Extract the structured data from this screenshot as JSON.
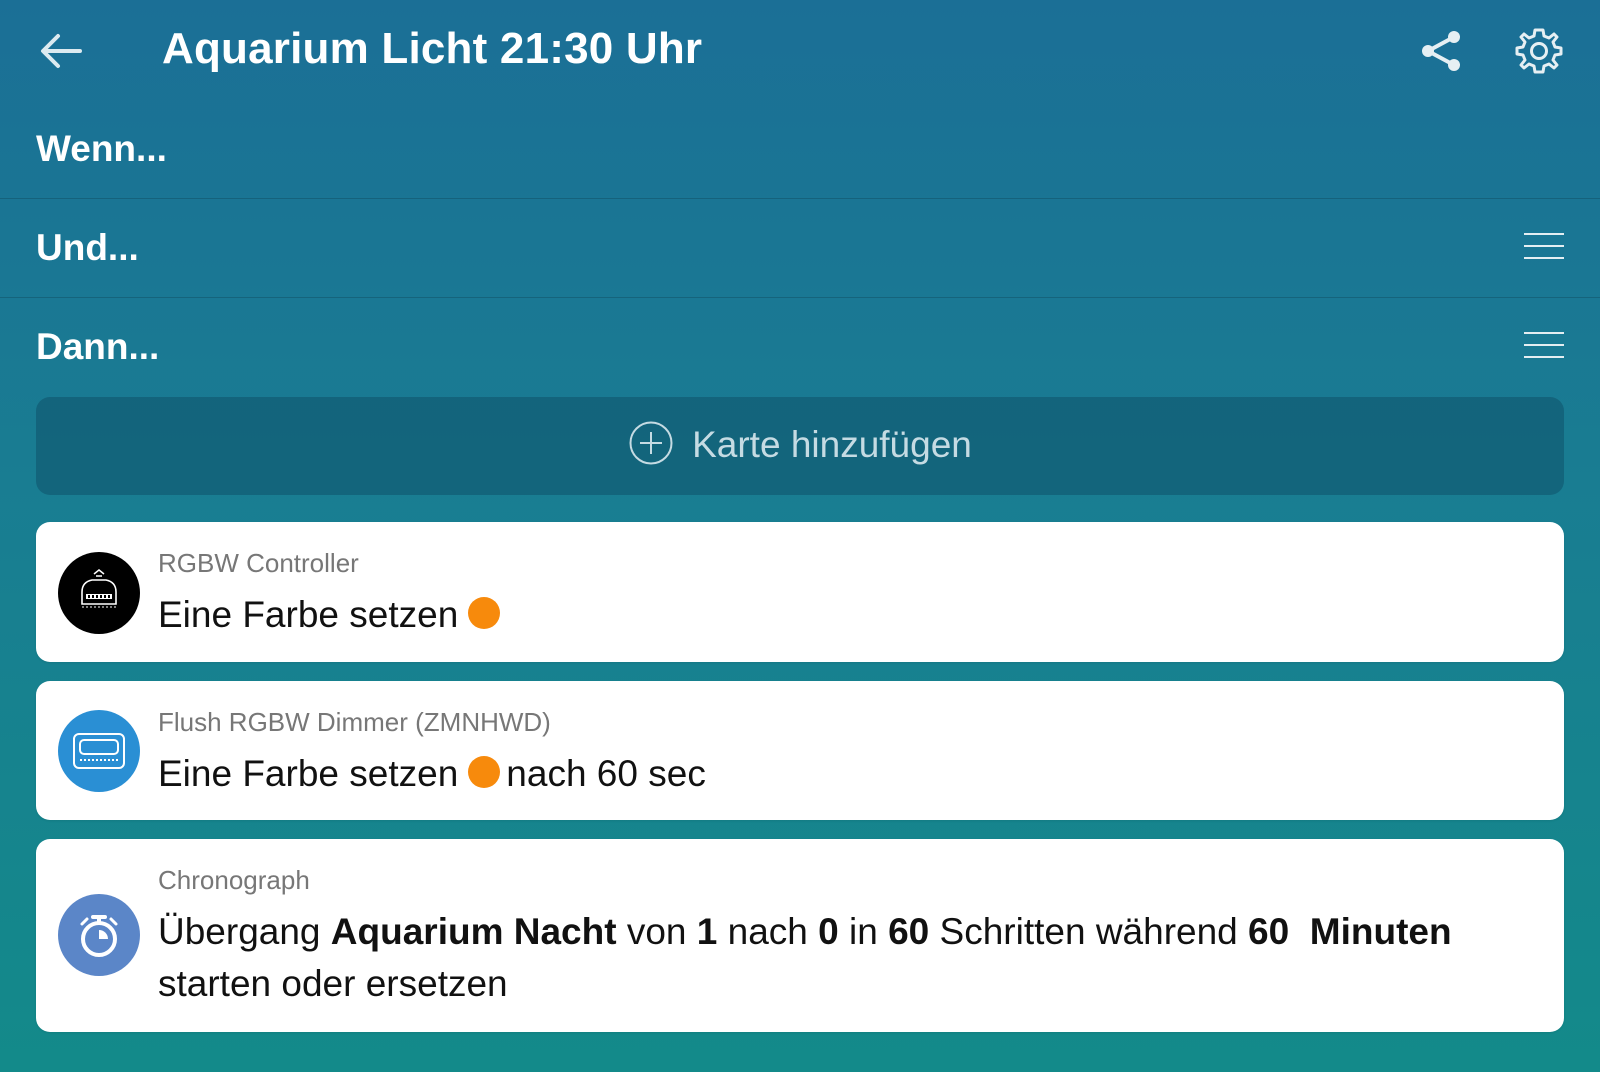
{
  "header": {
    "title": "Aquarium Licht 21:30 Uhr",
    "back_icon": "arrow-left-icon",
    "share_icon": "share-icon",
    "settings_icon": "gear-icon"
  },
  "sections": {
    "when": "Wenn...",
    "and": "Und...",
    "then": "Dann..."
  },
  "add_card": {
    "label": "Karte hinzufügen",
    "icon": "plus-circle-icon"
  },
  "cards": [
    {
      "device": "RGBW Controller",
      "action": "Eine Farbe setzen",
      "color": "#f78a0c",
      "icon": "fibaro-controller-icon"
    },
    {
      "device": "Flush RGBW Dimmer (ZMNHWD)",
      "action": "Eine Farbe setzen",
      "color": "#f78a0c",
      "suffix": "nach 60 sec",
      "icon": "dimmer-module-icon"
    },
    {
      "device": "Chronograph",
      "icon": "stopwatch-icon",
      "parts": {
        "p1": "Übergang ",
        "name": "Aquarium Nacht",
        "p2": " von ",
        "from": "1",
        "p3": " nach ",
        "to": "0",
        "p4": " in ",
        "steps": "60",
        "p5": " Schritten während ",
        "duration": "60  Minuten",
        "line2": "starten oder ersetzen"
      }
    }
  ],
  "colors": {
    "background_top": "#1b6f96",
    "background_bottom": "#138a8a",
    "accent_orange": "#f78a0c",
    "dimmer_icon_bg": "#2a8fd4",
    "chrono_icon_bg": "#5b86c8"
  }
}
